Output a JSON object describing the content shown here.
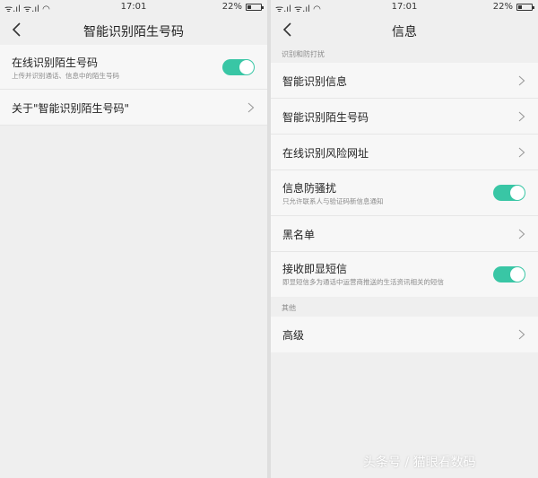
{
  "colors": {
    "accent": "#39c6a5",
    "background": "#efefef",
    "card": "#f7f7f7"
  },
  "left": {
    "status": {
      "signal": "ᯤ.ıl ᯤ.ıl ◠",
      "time": "17:01",
      "battery": "22%",
      "battery_level": 0.22
    },
    "title": "智能识别陌生号码",
    "back_icon": "chevron-left-icon",
    "items": [
      {
        "label": "在线识别陌生号码",
        "sub": "上传并识别通话、信息中的陌生号码",
        "toggle": true
      },
      {
        "label": "关于\"智能识别陌生号码\"",
        "chevron_icon": "chevron-right-icon"
      }
    ]
  },
  "right": {
    "status": {
      "signal": "ᯤ.ıl ᯤ.ıl ◠",
      "time": "17:01",
      "battery": "22%",
      "battery_level": 0.22
    },
    "title": "信息",
    "back_icon": "chevron-left-icon",
    "section1": {
      "header": "识别和防打扰",
      "items": [
        {
          "label": "智能识别信息"
        },
        {
          "label": "智能识别陌生号码"
        },
        {
          "label": "在线识别风险网址"
        },
        {
          "label": "信息防骚扰",
          "sub": "只允许联系人与验证码新信息通知",
          "toggle": true
        },
        {
          "label": "黑名单"
        },
        {
          "label": "接收即显短信",
          "sub": "即显短信多为通话中运营商推送的生活资讯相关的短信",
          "toggle": true
        }
      ]
    },
    "section2": {
      "header": "其他",
      "items": [
        {
          "label": "高级"
        }
      ]
    }
  },
  "watermark": "头条号 / 猫眼看数码"
}
